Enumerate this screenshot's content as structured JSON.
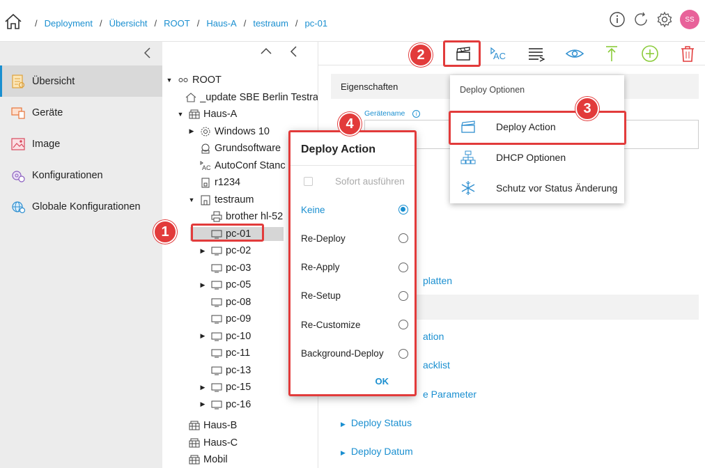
{
  "breadcrumb": [
    "Deployment",
    "Übersicht",
    "ROOT",
    "Haus-A",
    "testraum",
    "pc-01"
  ],
  "header": {
    "avatar_initials": "SS"
  },
  "sidebar": {
    "items": [
      {
        "label": "Übersicht",
        "icon": "overview-icon",
        "active": true
      },
      {
        "label": "Geräte",
        "icon": "devices-icon"
      },
      {
        "label": "Image",
        "icon": "image-icon"
      },
      {
        "label": "Konfigurationen",
        "icon": "configurations-icon"
      },
      {
        "label": "Globale Konfigurationen",
        "icon": "global-configurations-icon"
      }
    ]
  },
  "tree": {
    "nodes": [
      {
        "label": "ROOT"
      },
      {
        "label": "_update SBE Berlin Testra"
      },
      {
        "label": "Haus-A"
      },
      {
        "label": "Windows 10"
      },
      {
        "label": "Grundsoftware"
      },
      {
        "label": "AutoConf Stanc"
      },
      {
        "label": "r1234"
      },
      {
        "label": "testraum"
      },
      {
        "label": "brother hl-52"
      },
      {
        "label": "pc-01"
      },
      {
        "label": "pc-02"
      },
      {
        "label": "pc-03"
      },
      {
        "label": "pc-05"
      },
      {
        "label": "pc-08"
      },
      {
        "label": "pc-09"
      },
      {
        "label": "pc-10"
      },
      {
        "label": "pc-11"
      },
      {
        "label": "pc-13"
      },
      {
        "label": "pc-15"
      },
      {
        "label": "pc-16"
      },
      {
        "label": "Haus-B"
      },
      {
        "label": "Haus-C"
      },
      {
        "label": "Mobil"
      }
    ]
  },
  "content": {
    "properties_header": "Eigenschaften",
    "device_name_label": "Gerätename",
    "sections": [
      "platten",
      "ation",
      "acklist",
      "e Parameter",
      "Deploy Status",
      "Deploy Datum"
    ]
  },
  "deploy_menu": {
    "title": "Deploy Optionen",
    "items": [
      "Deploy Action",
      "DHCP Optionen",
      "Schutz vor Status Änderung"
    ]
  },
  "dialog": {
    "title": "Deploy Action",
    "immediate_label": "Sofort ausführen",
    "options": [
      "Keine",
      "Re-Deploy",
      "Re-Apply",
      "Re-Setup",
      "Re-Customize",
      "Background-Deploy"
    ],
    "selected": "Keine",
    "ok_label": "OK"
  },
  "annotations": [
    "1",
    "2",
    "3",
    "4"
  ],
  "colors": {
    "accent": "#1a8fd0",
    "annotation": "#e23b3b",
    "avatar": "#e8629a"
  }
}
